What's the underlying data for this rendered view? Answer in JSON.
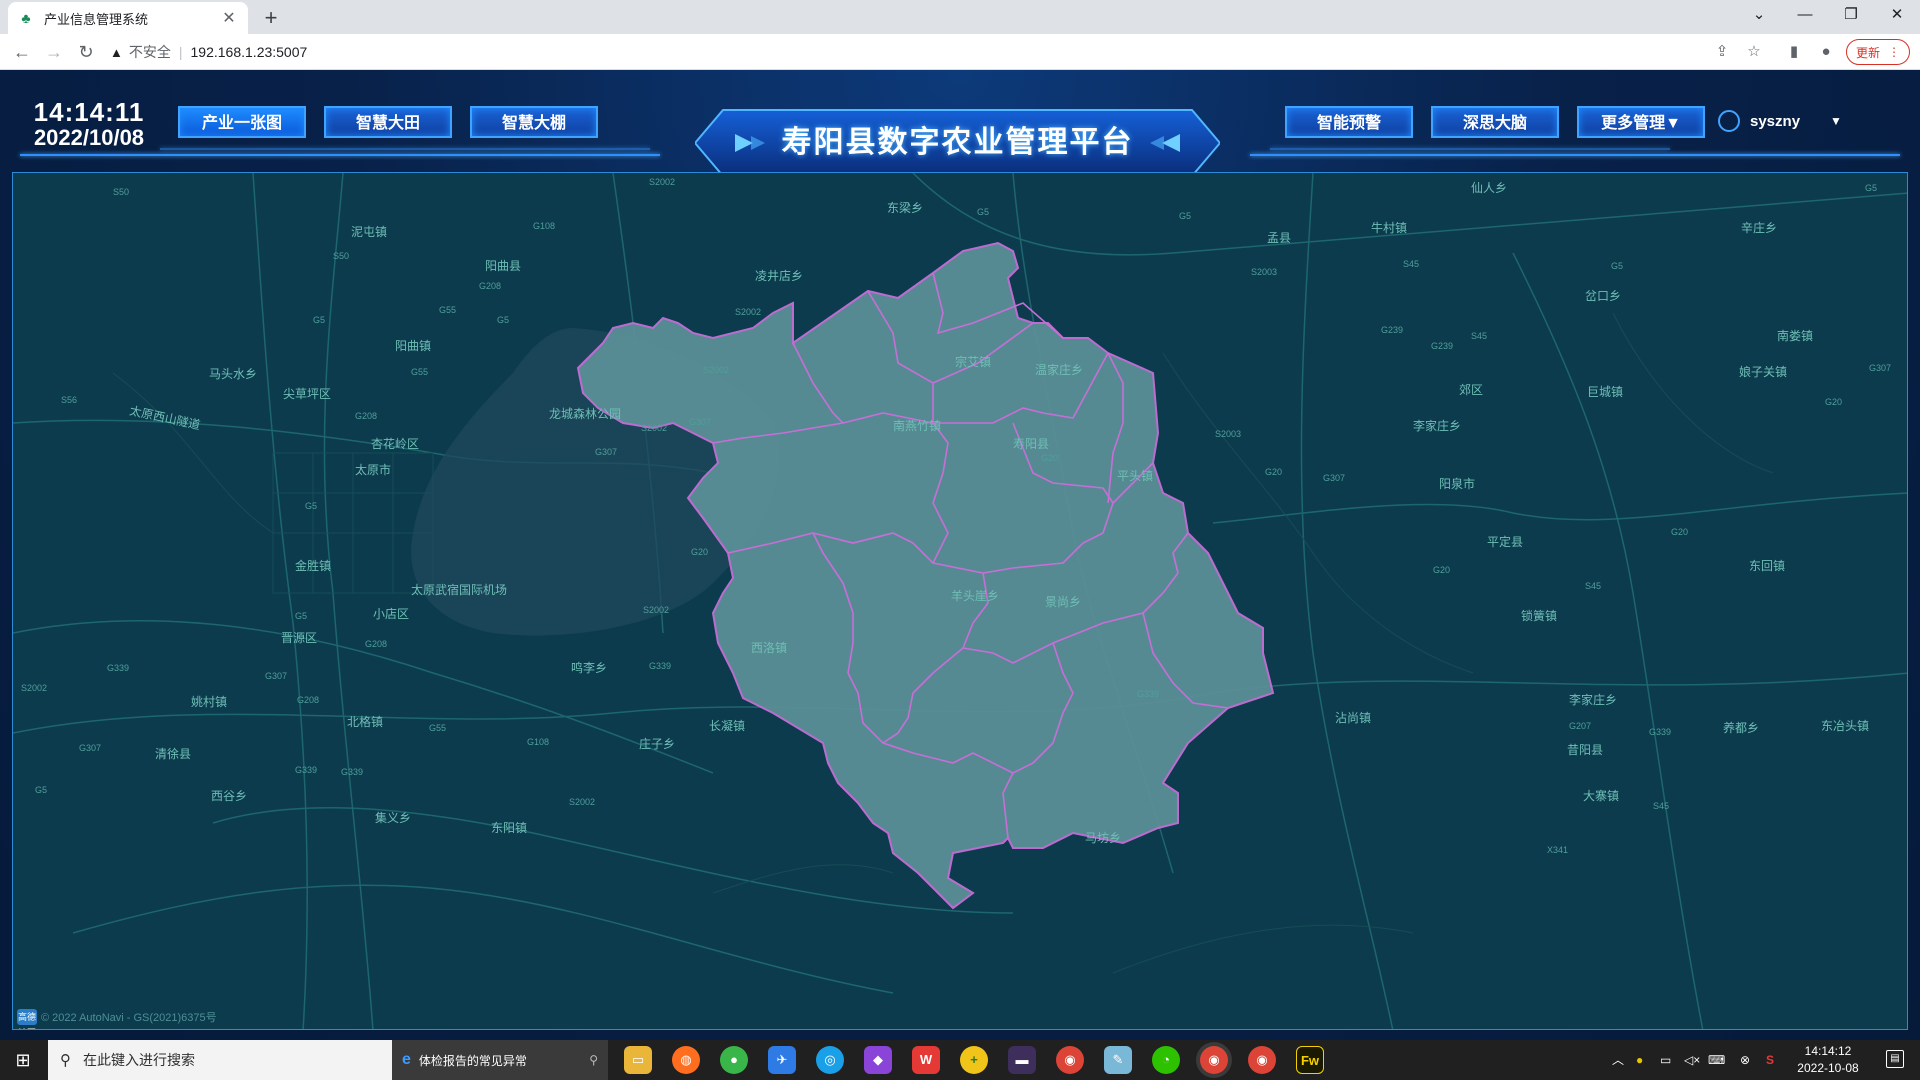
{
  "browser": {
    "tab_title": "产业信息管理系统",
    "address_warning": "不安全",
    "url": "192.168.1.23:5007",
    "update_label": "更新"
  },
  "header": {
    "time": "14:14:11",
    "date": "2022/10/08",
    "title": "寿阳县数字农业管理平台",
    "nav_left": [
      "产业一张图",
      "智慧大田",
      "智慧大棚"
    ],
    "nav_right": [
      "智能预警",
      "深思大脑",
      "更多管理▼"
    ],
    "username": "syszny",
    "accent_color": "#1e8cff"
  },
  "map": {
    "place_labels": [
      {
        "text": "仙人乡"
      },
      {
        "text": "东梁乡"
      },
      {
        "text": "孟县"
      },
      {
        "text": "牛村镇"
      },
      {
        "text": "辛庄乡"
      },
      {
        "text": "泥屯镇"
      },
      {
        "text": "阳曲县"
      },
      {
        "text": "凌井店乡"
      },
      {
        "text": "岔口乡"
      },
      {
        "text": "阳曲镇"
      },
      {
        "text": "南娄镇"
      },
      {
        "text": "马头水乡"
      },
      {
        "text": "尖草坪区"
      },
      {
        "text": "宗艾镇"
      },
      {
        "text": "温家庄乡"
      },
      {
        "text": "郊区"
      },
      {
        "text": "巨城镇"
      },
      {
        "text": "娘子关镇"
      },
      {
        "text": "龙城森林公园"
      },
      {
        "text": "李家庄乡"
      },
      {
        "text": "南燕竹镇"
      },
      {
        "text": "杏花岭区"
      },
      {
        "text": "寿阳县"
      },
      {
        "text": "太原市"
      },
      {
        "text": "平头镇"
      },
      {
        "text": "阳泉市"
      },
      {
        "text": "平定县"
      },
      {
        "text": "金胜镇"
      },
      {
        "text": "东回镇"
      },
      {
        "text": "太原武宿国际机场"
      },
      {
        "text": "羊头崖乡"
      },
      {
        "text": "景尚乡"
      },
      {
        "text": "小店区"
      },
      {
        "text": "锁簧镇"
      },
      {
        "text": "晋源区"
      },
      {
        "text": "西洛镇"
      },
      {
        "text": "鸣李乡"
      },
      {
        "text": "北格镇"
      },
      {
        "text": "长凝镇"
      },
      {
        "text": "沾尚镇"
      },
      {
        "text": "李家庄乡"
      },
      {
        "text": "养都乡"
      },
      {
        "text": "东冶头镇"
      },
      {
        "text": "清徐县"
      },
      {
        "text": "庄子乡"
      },
      {
        "text": "昔阳县"
      },
      {
        "text": "西谷乡"
      },
      {
        "text": "大寨镇"
      },
      {
        "text": "集义乡"
      },
      {
        "text": "东阳镇"
      },
      {
        "text": "马坊乡"
      },
      {
        "text": "姚村镇"
      },
      {
        "text": "太原西山隧道"
      }
    ],
    "road_labels": [
      {
        "text": "S50"
      },
      {
        "text": "S2002"
      },
      {
        "text": "G5"
      },
      {
        "text": "G5"
      },
      {
        "text": "G5"
      },
      {
        "text": "S2003"
      },
      {
        "text": "S45"
      },
      {
        "text": "G5"
      },
      {
        "text": "G108"
      },
      {
        "text": "S50"
      },
      {
        "text": "G208"
      },
      {
        "text": "G55"
      },
      {
        "text": "G5"
      },
      {
        "text": "S2002"
      },
      {
        "text": "G5"
      },
      {
        "text": "G239"
      },
      {
        "text": "G239"
      },
      {
        "text": "S45"
      },
      {
        "text": "G307"
      },
      {
        "text": "G55"
      },
      {
        "text": "S2002"
      },
      {
        "text": "S56"
      },
      {
        "text": "G208"
      },
      {
        "text": "G307"
      },
      {
        "text": "S2002"
      },
      {
        "text": "S2003"
      },
      {
        "text": "G20"
      },
      {
        "text": "G20"
      },
      {
        "text": "G307"
      },
      {
        "text": "G20"
      },
      {
        "text": "G5"
      },
      {
        "text": "G307"
      },
      {
        "text": "G20"
      },
      {
        "text": "G20"
      },
      {
        "text": "S45"
      },
      {
        "text": "G20"
      },
      {
        "text": "S2002"
      },
      {
        "text": "G5"
      },
      {
        "text": "G208"
      },
      {
        "text": "G339"
      },
      {
        "text": "G339"
      },
      {
        "text": "S2002"
      },
      {
        "text": "G307"
      },
      {
        "text": "G208"
      },
      {
        "text": "G339"
      },
      {
        "text": "G307"
      },
      {
        "text": "G55"
      },
      {
        "text": "G108"
      },
      {
        "text": "G339"
      },
      {
        "text": "G339"
      },
      {
        "text": "G207"
      },
      {
        "text": "G339"
      },
      {
        "text": "S2002"
      },
      {
        "text": "S45"
      },
      {
        "text": "X341"
      },
      {
        "text": "G5"
      }
    ],
    "attribution": "© 2022 AutoNavi - GS(2021)6375号",
    "attribution_logo": "高德地图",
    "county_fill": "#5a8f97",
    "boundary_color": "#c66fd6"
  },
  "taskbar": {
    "search_placeholder": "在此键入进行搜索",
    "ie_tab_label": "体检报告的常见异常",
    "apps": [
      "file-explorer",
      "firefox",
      "green-app",
      "feather-app",
      "qq-browser",
      "visual-studio",
      "wps",
      "plus-app",
      "terminal",
      "chrome",
      "notepad-app",
      "wechat",
      "chrome",
      "chrome",
      "fireworks"
    ],
    "fw_label": "Fw",
    "time": "14:14:12",
    "date": "2022-10-08"
  }
}
